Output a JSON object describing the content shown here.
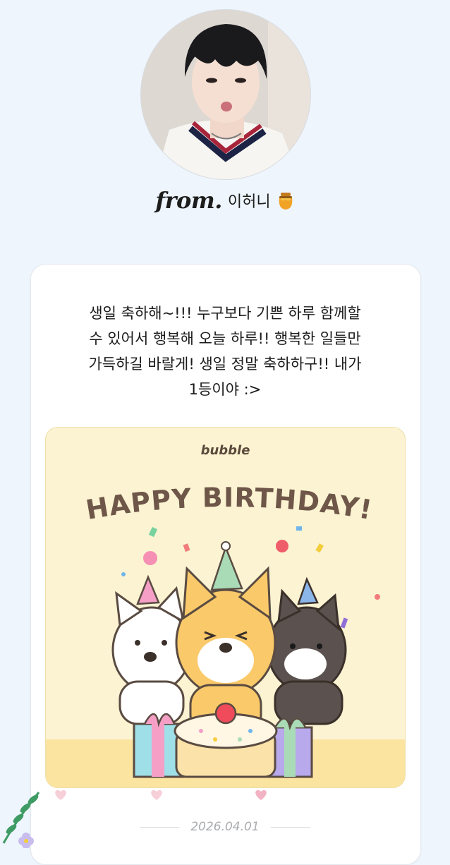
{
  "profile": {
    "from_label": "from.",
    "name": "이허니",
    "honey_icon": "honey-pot-icon"
  },
  "message": {
    "text": "생일 축하해~!!! 누구보다 기쁜 하루 함께할\n수 있어서 행복해 오늘 하루!! 행복한 일들만\n가득하길 바랄게! 생일 정말 축하하구!! 내가\n1등이야 :>"
  },
  "birthday_card": {
    "logo": "bubble",
    "title": "HAPPY BIRTHDAY!",
    "colors": {
      "background": "#fbf3d2",
      "floor": "#fbe3a0",
      "title": "#6e5648"
    }
  },
  "footer": {
    "date": "2026.04.01"
  },
  "colors": {
    "page_bg": "#eef5fd",
    "card_bg": "#ffffff",
    "text": "#1a1a1a",
    "date": "#a9abae"
  }
}
